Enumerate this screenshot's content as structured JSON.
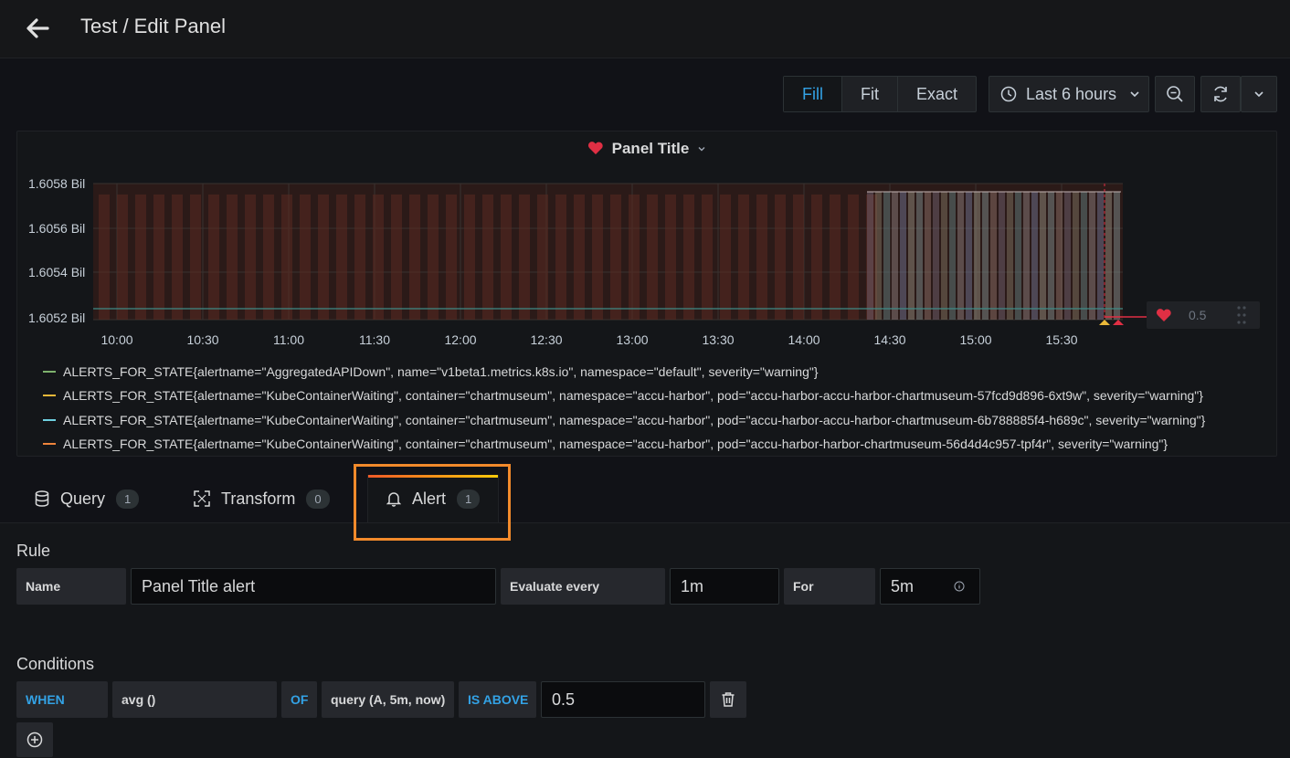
{
  "header": {
    "title": "Test / Edit Panel"
  },
  "toolbar": {
    "display_modes": [
      "Fill",
      "Fit",
      "Exact"
    ],
    "active_mode": "Fill",
    "time_range": "Last 6 hours"
  },
  "panel": {
    "title": "Panel Title",
    "threshold_value": "0.5",
    "y_ticks": [
      "1.6058 Bil",
      "1.6056 Bil",
      "1.6054 Bil",
      "1.6052 Bil"
    ],
    "x_ticks": [
      "10:00",
      "10:30",
      "11:00",
      "11:30",
      "12:00",
      "12:30",
      "13:00",
      "13:30",
      "14:00",
      "14:30",
      "15:00",
      "15:30"
    ],
    "legend": [
      {
        "label": "ALERTS_FOR_STATE{alertname=\"AggregatedAPIDown\", name=\"v1beta1.metrics.k8s.io\", namespace=\"default\", severity=\"warning\"}",
        "color": "#7eb26d"
      },
      {
        "label": "ALERTS_FOR_STATE{alertname=\"KubeContainerWaiting\", container=\"chartmuseum\", namespace=\"accu-harbor\", pod=\"accu-harbor-accu-harbor-chartmuseum-57fcd9d896-6xt9w\", severity=\"warning\"}",
        "color": "#eab839"
      },
      {
        "label": "ALERTS_FOR_STATE{alertname=\"KubeContainerWaiting\", container=\"chartmuseum\", namespace=\"accu-harbor\", pod=\"accu-harbor-accu-harbor-chartmuseum-6b788885f4-h689c\", severity=\"warning\"}",
        "color": "#6ed0e0"
      },
      {
        "label": "ALERTS_FOR_STATE{alertname=\"KubeContainerWaiting\", container=\"chartmuseum\", namespace=\"accu-harbor\", pod=\"accu-harbor-harbor-chartmuseum-56d4d4c957-tpf4r\", severity=\"warning\"}",
        "color": "#ef843c"
      }
    ]
  },
  "tabs": [
    {
      "label": "Query",
      "count": "1"
    },
    {
      "label": "Transform",
      "count": "0"
    },
    {
      "label": "Alert",
      "count": "1"
    }
  ],
  "rule": {
    "section": "Rule",
    "name_label": "Name",
    "name_value": "Panel Title alert",
    "evaluate_label": "Evaluate every",
    "evaluate_value": "1m",
    "for_label": "For",
    "for_value": "5m"
  },
  "conditions": {
    "section": "Conditions",
    "when": "WHEN",
    "reducer": "avg ()",
    "of": "OF",
    "query": "query (A, 5m, now)",
    "evaluator": "IS ABOVE",
    "value": "0.5"
  },
  "colors": {
    "accent": "#33a2e5",
    "highlight": "#f28a2b",
    "alert_red": "#e02f44"
  }
}
